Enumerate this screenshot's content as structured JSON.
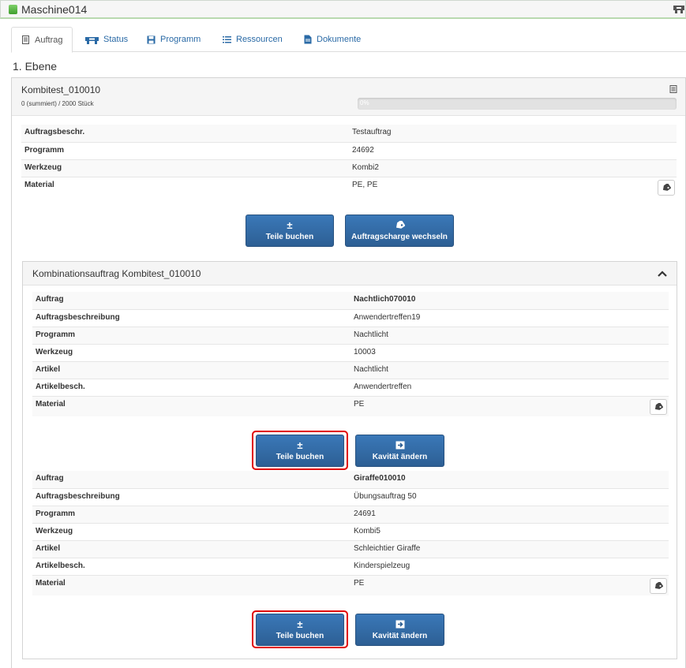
{
  "machine": {
    "name": "Maschine014"
  },
  "tabs": [
    {
      "label": "Auftrag",
      "icon": "document-icon"
    },
    {
      "label": "Status",
      "icon": "machine-status-icon"
    },
    {
      "label": "Programm",
      "icon": "save-icon"
    },
    {
      "label": "Ressourcen",
      "icon": "list-icon"
    },
    {
      "label": "Dokumente",
      "icon": "file-icon"
    }
  ],
  "level_title": "1. Ebene",
  "order": {
    "name": "Kombitest_010010",
    "quantity": "0 (summiert) / 2000 Stück",
    "progress_label": "0%",
    "progress_fraction": 0,
    "details": [
      {
        "key": "Auftragsbeschr.",
        "value": "Testauftrag"
      },
      {
        "key": "Programm",
        "value": "24692"
      },
      {
        "key": "Werkzeug",
        "value": "Kombi2"
      },
      {
        "key": "Material",
        "value": "PE, PE"
      }
    ],
    "buttons": {
      "book_parts": "Teile buchen",
      "change_batch": "Auftragscharge wechseln"
    }
  },
  "combination": {
    "title": "Kombinationsauftrag Kombitest_010010",
    "orders": [
      {
        "details": [
          {
            "key": "Auftrag",
            "value": "Nachtlich070010"
          },
          {
            "key": "Auftragsbeschreibung",
            "value": "Anwendertreffen19"
          },
          {
            "key": "Programm",
            "value": "Nachtlicht"
          },
          {
            "key": "Werkzeug",
            "value": "10003"
          },
          {
            "key": "Artikel",
            "value": "Nachtlicht"
          },
          {
            "key": "Artikelbesch.",
            "value": "Anwendertreffen"
          },
          {
            "key": "Material",
            "value": "PE"
          }
        ],
        "book_parts": "Teile buchen",
        "change_cavity": "Kavität ändern"
      },
      {
        "details": [
          {
            "key": "Auftrag",
            "value": "Giraffe010010"
          },
          {
            "key": "Auftragsbeschreibung",
            "value": "Übungsauftrag 50"
          },
          {
            "key": "Programm",
            "value": "24691"
          },
          {
            "key": "Werkzeug",
            "value": "Kombi5"
          },
          {
            "key": "Artikel",
            "value": "Schleichtier Giraffe"
          },
          {
            "key": "Artikelbesch.",
            "value": "Kinderspielzeug"
          },
          {
            "key": "Material",
            "value": "PE"
          }
        ],
        "book_parts": "Teile buchen",
        "change_cavity": "Kavität ändern"
      }
    ]
  },
  "colors": {
    "primary_button": "#2d5f94",
    "highlight": "#e00000",
    "link": "#2a6aa6",
    "status_ok": "#4caf3a"
  }
}
